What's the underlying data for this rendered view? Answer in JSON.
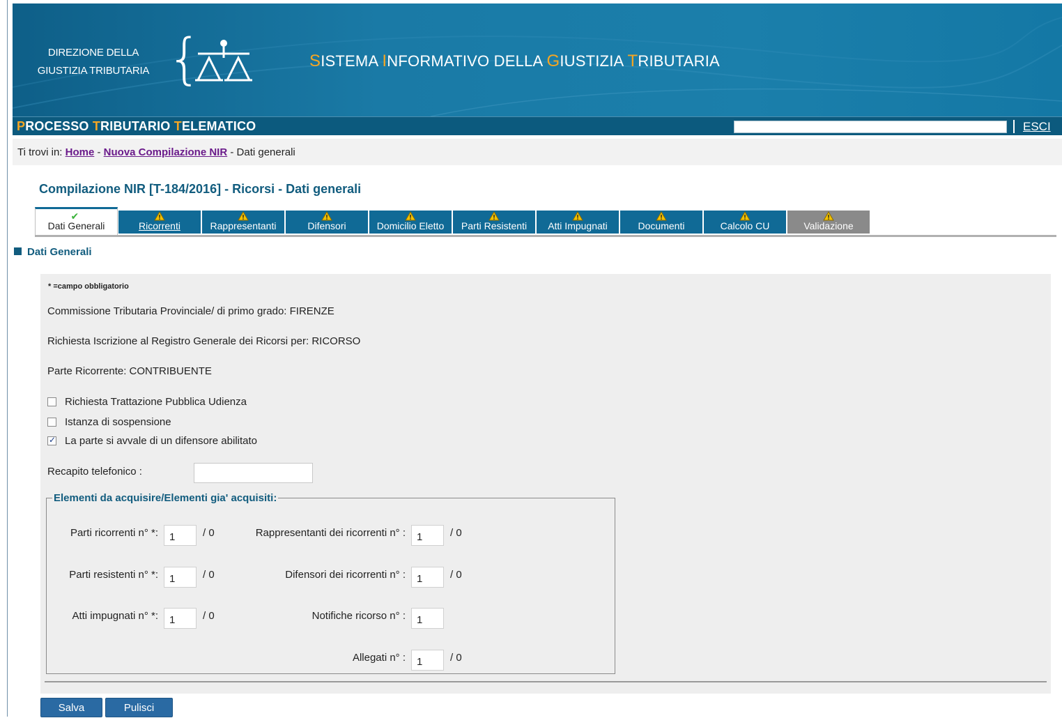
{
  "header": {
    "org_line1": "DIREZIONE DELLA",
    "org_line2": "GIUSTIZIA TRIBUTARIA",
    "system_title": {
      "w1_cap": "S",
      "w1_rest": "ISTEMA ",
      "w2_cap": "I",
      "w2_rest": "NFORMATIVO DELLA ",
      "w3_cap": "G",
      "w3_rest": "IUSTIZIA ",
      "w4_cap": "T",
      "w4_rest": "RIBUTARIA"
    },
    "icons": {
      "logo": "scales-of-justice-icon"
    },
    "colors": {
      "accent": "#f5a623",
      "header_bg": "#1a7aa6",
      "bar_bg": "#0c5a7e"
    }
  },
  "ptt": {
    "p1_cap": "P",
    "p1_rest": "ROCESSO ",
    "p2_cap": "T",
    "p2_rest": "RIBUTARIO ",
    "p3_cap": "T",
    "p3_rest": "ELEMATICO",
    "exit_label": "ESCI"
  },
  "breadcrumb": {
    "prefix": "Ti trovi in:",
    "home": "Home",
    "sep": "-",
    "nuova": "Nuova Compilazione NIR",
    "current": "Dati generali"
  },
  "page_title": "Compilazione NIR [T-184/2016] - Ricorsi - Dati generali",
  "tabs": [
    {
      "label": "Dati Generali",
      "status": "ok"
    },
    {
      "label": "Ricorrenti",
      "status": "warning"
    },
    {
      "label": "Rappresentanti",
      "status": "warning"
    },
    {
      "label": "Difensori",
      "status": "warning"
    },
    {
      "label": "Domicilio Eletto",
      "status": "warning"
    },
    {
      "label": "Parti Resistenti",
      "status": "warning"
    },
    {
      "label": "Atti Impugnati",
      "status": "warning"
    },
    {
      "label": "Documenti",
      "status": "warning"
    },
    {
      "label": "Calcolo CU",
      "status": "warning"
    },
    {
      "label": "Validazione",
      "status": "warning"
    }
  ],
  "section_title": "Dati Generali",
  "form": {
    "required_note": "* =campo obbligatorio",
    "commissione": "Commissione Tributaria Provinciale/ di primo grado: FIRENZE",
    "richiesta": "Richiesta Iscrizione al Registro Generale dei Ricorsi per: RICORSO",
    "parte": "Parte Ricorrente: CONTRIBUENTE",
    "checkboxes": [
      {
        "label": "Richiesta Trattazione Pubblica Udienza",
        "checked": false
      },
      {
        "label": "Istanza di sospensione",
        "checked": false
      },
      {
        "label": "La parte si avvale di un difensore abilitato",
        "checked": true
      }
    ],
    "phone_label": "Recapito telefonico  :",
    "phone_value": "",
    "fieldset_legend": "Elementi da acquisire/Elementi gia' acquisiti:",
    "fields": {
      "parti_ricorrenti": {
        "label": "Parti ricorrenti n° *:",
        "value": "1",
        "acquired": "/ 0"
      },
      "parti_resistenti": {
        "label": "Parti resistenti n° *:",
        "value": "1",
        "acquired": "/ 0"
      },
      "atti_impugnati": {
        "label": "Atti impugnati n° *:",
        "value": "1",
        "acquired": "/ 0"
      },
      "rappresentanti": {
        "label": "Rappresentanti dei ricorrenti n° :",
        "value": "1",
        "acquired": "/ 0"
      },
      "difensori": {
        "label": "Difensori dei ricorrenti n° :",
        "value": "1",
        "acquired": "/ 0"
      },
      "notifiche": {
        "label": "Notifiche ricorso n° :",
        "value": "1"
      },
      "allegati": {
        "label": "Allegati n° :",
        "value": "1",
        "acquired": "/ 0"
      }
    }
  },
  "buttons": {
    "save": "Salva",
    "clear": "Pulisci"
  }
}
